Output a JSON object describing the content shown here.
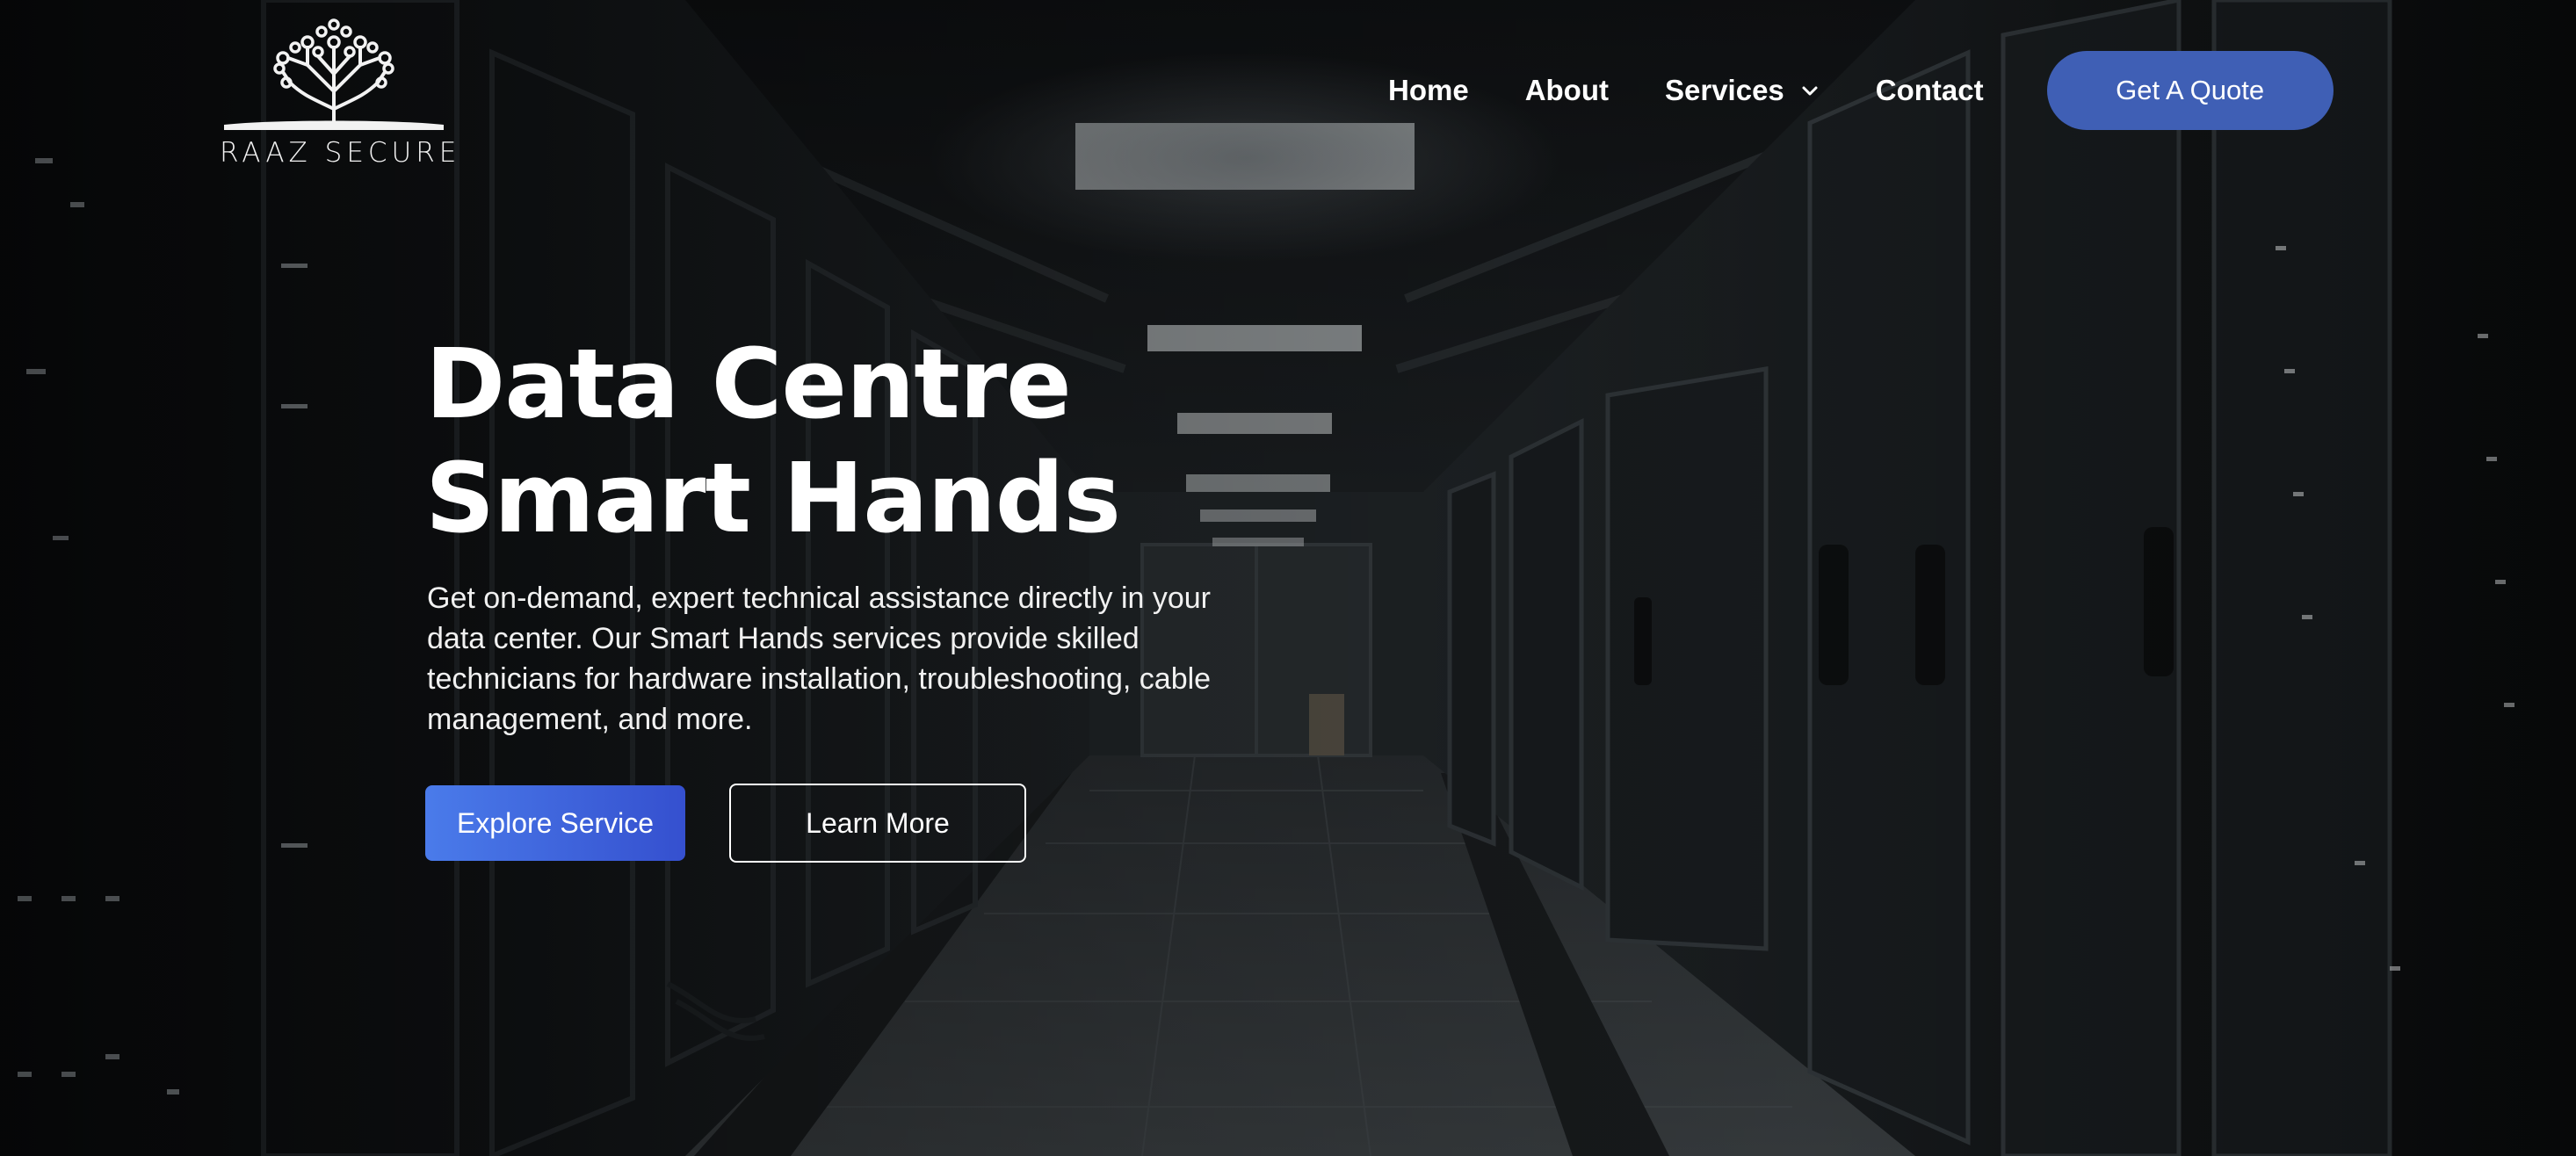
{
  "brand": {
    "name": "RAAZ SECURE",
    "logo_icon": "tree-circuit-icon"
  },
  "nav": {
    "items": [
      {
        "label": "Home"
      },
      {
        "label": "About"
      },
      {
        "label": "Services",
        "icon": "chevron-down-icon"
      },
      {
        "label": "Contact"
      }
    ],
    "cta_label": "Get A Quote"
  },
  "hero": {
    "title_line1": "Data Centre",
    "title_line2": "Smart Hands",
    "description": "Get on-demand, expert technical assistance directly in your data center. Our Smart Hands services provide skilled technicians for hardware installation, troubleshooting, cable management, and more.",
    "primary_button": "Explore Service",
    "secondary_button": "Learn More"
  },
  "colors": {
    "accent": "#3f5fb5",
    "primary_gradient_start": "#4a7bea",
    "primary_gradient_end": "#3550cf",
    "text": "#ffffff",
    "background": "#0b0d10"
  }
}
